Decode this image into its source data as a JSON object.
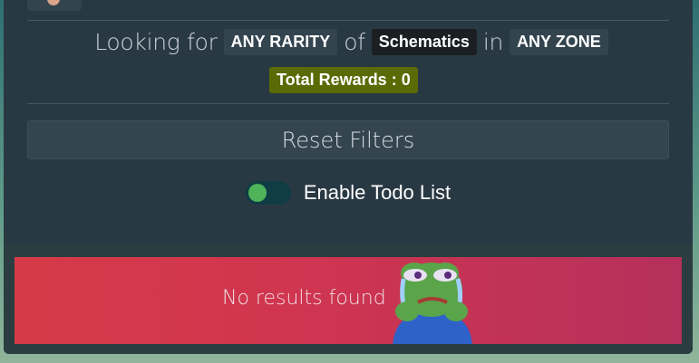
{
  "filters": {
    "prefix": "Looking for",
    "rarity": "ANY RARITY",
    "of_word": "of",
    "category": "Schematics",
    "in_word": "in",
    "zone": "ANY ZONE"
  },
  "rewards": {
    "label": "Total Rewards : 0"
  },
  "reset_button": {
    "label": "Reset Filters"
  },
  "todo_toggle": {
    "label": "Enable Todo List",
    "enabled": true
  },
  "results": {
    "empty_message": "No results found"
  },
  "colors": {
    "panel": "#293944",
    "reward_badge": "#5a6b05",
    "toggle_knob": "#4eb35a",
    "banner": "#d63a48"
  },
  "icons": {
    "empty_state": "crying-frog-icon",
    "top": "avatar-icon"
  }
}
